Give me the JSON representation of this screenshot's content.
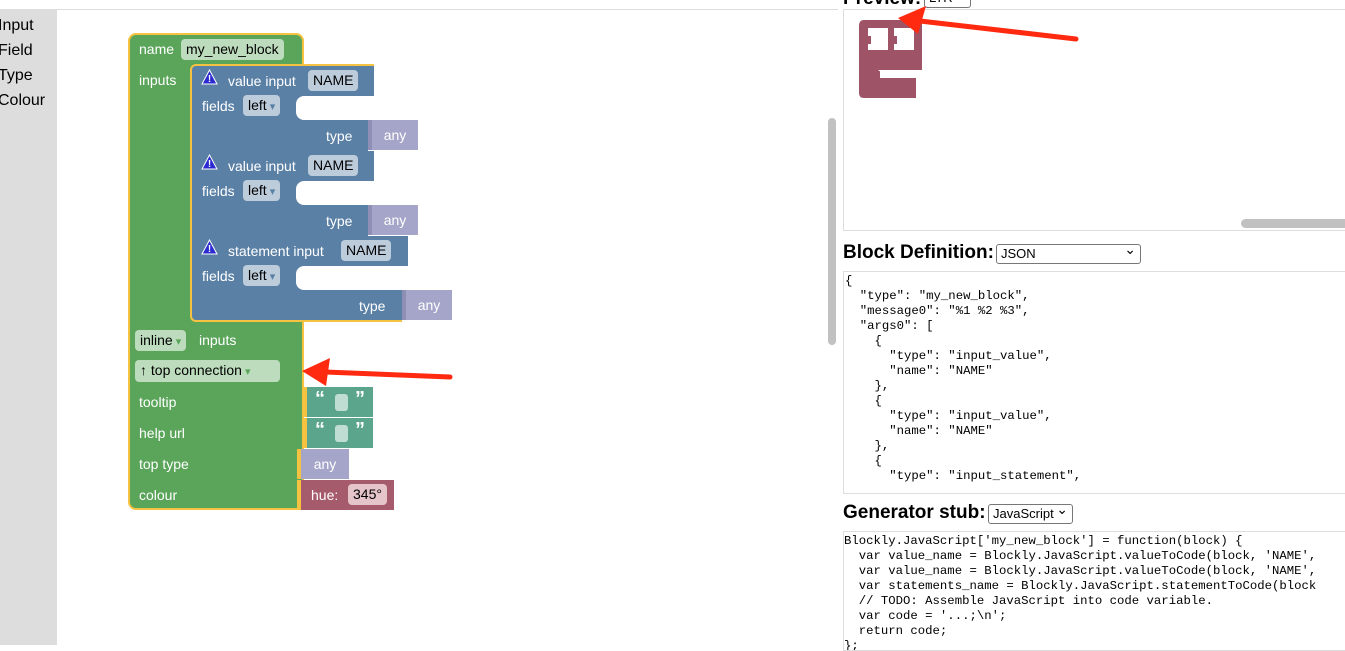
{
  "sidebar": {
    "categories": [
      "Input",
      "Field",
      "Type",
      "Colour"
    ]
  },
  "block": {
    "name_label": "name",
    "name_value": "my_new_block",
    "inputs_label": "inputs",
    "inputs": [
      {
        "label": "value input",
        "name": "NAME",
        "fields_label": "fields",
        "align": "left",
        "type_label": "type",
        "type": "any"
      },
      {
        "label": "value input",
        "name": "NAME",
        "fields_label": "fields",
        "align": "left",
        "type_label": "type",
        "type": "any"
      },
      {
        "label": "statement input",
        "name": "NAME",
        "fields_label": "fields",
        "align": "left",
        "type_label": "type",
        "type": "any"
      }
    ],
    "inline_value": "inline",
    "inline_suffix": "inputs",
    "connection_value": "↑ top connection",
    "tooltip_label": "tooltip",
    "open_quote": "“",
    "close_quote": "”",
    "helpurl_label": "help url",
    "toptype_label": "top type",
    "toptype_value": "any",
    "colour_label": "colour",
    "hue_label": "hue:",
    "hue_value": "345°"
  },
  "colors": {
    "block_green": "#5ba55b",
    "input_blue": "#5b80a5",
    "type_any": "#a5a5c9",
    "text_block": "#5ba58c",
    "hue_block": "#a55b6b",
    "annotation_arrow": "#ff2a10"
  },
  "preview": {
    "title": "Preview:",
    "direction": "LTR"
  },
  "definition": {
    "title": "Block Definition:",
    "format": "JSON",
    "code": "{\n  \"type\": \"my_new_block\",\n  \"message0\": \"%1 %2 %3\",\n  \"args0\": [\n    {\n      \"type\": \"input_value\",\n      \"name\": \"NAME\"\n    },\n    {\n      \"type\": \"input_value\",\n      \"name\": \"NAME\"\n    },\n    {\n      \"type\": \"input_statement\","
  },
  "generator": {
    "title": "Generator stub:",
    "language": "JavaScript",
    "code": "Blockly.JavaScript['my_new_block'] = function(block) {\n  var value_name = Blockly.JavaScript.valueToCode(block, 'NAME',\n  var value_name = Blockly.JavaScript.valueToCode(block, 'NAME',\n  var statements_name = Blockly.JavaScript.statementToCode(block\n  // TODO: Assemble JavaScript into code variable.\n  var code = '...;\\n';\n  return code;\n};"
  }
}
